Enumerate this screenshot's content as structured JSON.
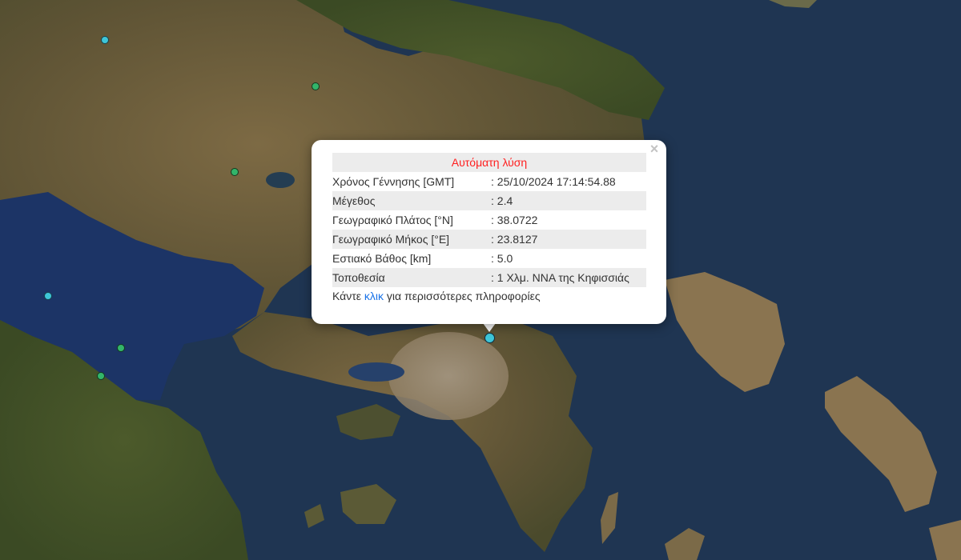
{
  "popup": {
    "title": "Αυτόματη λύση",
    "close_symbol": "×",
    "rows": [
      {
        "label": "Χρόνος Γέννησης [GMT]",
        "value": ": 25/10/2024 17:14:54.88"
      },
      {
        "label": "Μέγεθος",
        "value": ": 2.4"
      },
      {
        "label": "Γεωγραφικό Πλάτος [°N]",
        "value": ": 38.0722"
      },
      {
        "label": "Γεωγραφικό Μήκος [°E]",
        "value": ": 23.8127"
      },
      {
        "label": "Εστιακό Βάθος [km]",
        "value": ": 5.0"
      },
      {
        "label": "Τοποθεσία",
        "value": ": 1 Χλμ. ΝΝΑ της Κηφισσιάς"
      }
    ],
    "footer_prefix": "Κάντε ",
    "footer_link": "κλικ",
    "footer_suffix": " για περισσότερες πληροφορίες"
  },
  "colors": {
    "sea": "#1f3552",
    "land": "#6e5a3a",
    "marker_recent": "#3ec6d8",
    "marker_older": "#33b56a",
    "title_red": "#ff1f1f",
    "link_blue": "#1a73e8"
  },
  "markers": [
    {
      "type": "recent",
      "icon": "earthquake-marker"
    },
    {
      "type": "older",
      "icon": "earthquake-marker"
    },
    {
      "type": "older",
      "icon": "earthquake-marker"
    },
    {
      "type": "recent",
      "icon": "earthquake-marker"
    },
    {
      "type": "older",
      "icon": "earthquake-marker"
    },
    {
      "type": "older",
      "icon": "earthquake-marker"
    },
    {
      "type": "recent",
      "icon": "selected-earthquake-marker"
    }
  ]
}
